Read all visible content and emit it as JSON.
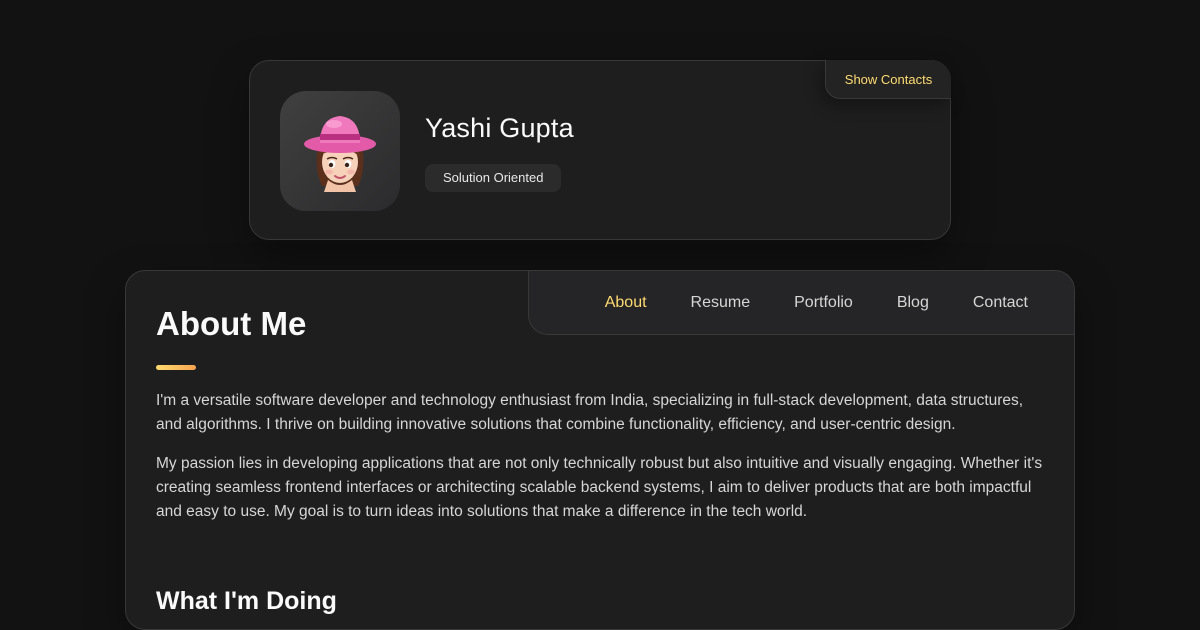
{
  "profile": {
    "name": "Yashi Gupta",
    "title": "Solution Oriented",
    "show_contacts_label": "Show Contacts",
    "avatar_icon": "memoji-avatar"
  },
  "navbar": {
    "items": [
      {
        "label": "About",
        "active": true
      },
      {
        "label": "Resume",
        "active": false
      },
      {
        "label": "Portfolio",
        "active": false
      },
      {
        "label": "Blog",
        "active": false
      },
      {
        "label": "Contact",
        "active": false
      }
    ]
  },
  "about": {
    "title": "About Me",
    "paragraphs": [
      "I'm a versatile software developer and technology enthusiast from India, specializing in full-stack development, data structures, and algorithms. I thrive on building innovative solutions that combine functionality, efficiency, and user-centric design.",
      "My passion lies in developing applications that are not only technically robust but also intuitive and visually engaging. Whether it's creating seamless frontend interfaces or architecting scalable backend systems, I aim to deliver products that are both impactful and easy to use. My goal is to turn ideas into solutions that make a difference in the tech world."
    ],
    "section_title": "What I'm Doing"
  },
  "colors": {
    "accent": "#ffdb70",
    "background": "#121212",
    "card": "#1e1e1f",
    "border": "#383838"
  }
}
